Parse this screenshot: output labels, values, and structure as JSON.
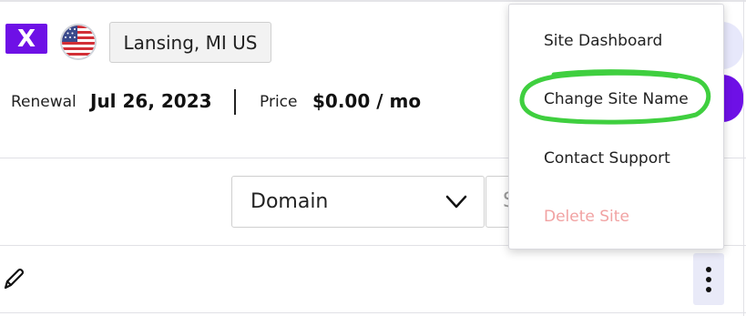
{
  "site": {
    "brand_letter": "X",
    "location": "Lansing, MI US",
    "renewal_label": "Renewal",
    "renewal_date": "Jul 26, 2023",
    "price_label": "Price",
    "price_value": "$0.00 / mo"
  },
  "filter": {
    "type_selected": "Domain",
    "search_partial": "S"
  },
  "icons": {
    "brand": "x-logo-icon",
    "flag": "us-flag-icon",
    "dropdown": "chevron-down-icon",
    "edit": "pencil-icon",
    "more": "kebab-menu-icon"
  },
  "menu": {
    "items": [
      {
        "label": "Site Dashboard"
      },
      {
        "label": "Change Site Name"
      },
      {
        "label": "Contact Support"
      },
      {
        "label": "Delete Site"
      }
    ]
  },
  "colors": {
    "brand_purple": "#6e10e6",
    "highlight_green": "#3fcf3f",
    "danger_text": "#f1a2a2"
  }
}
